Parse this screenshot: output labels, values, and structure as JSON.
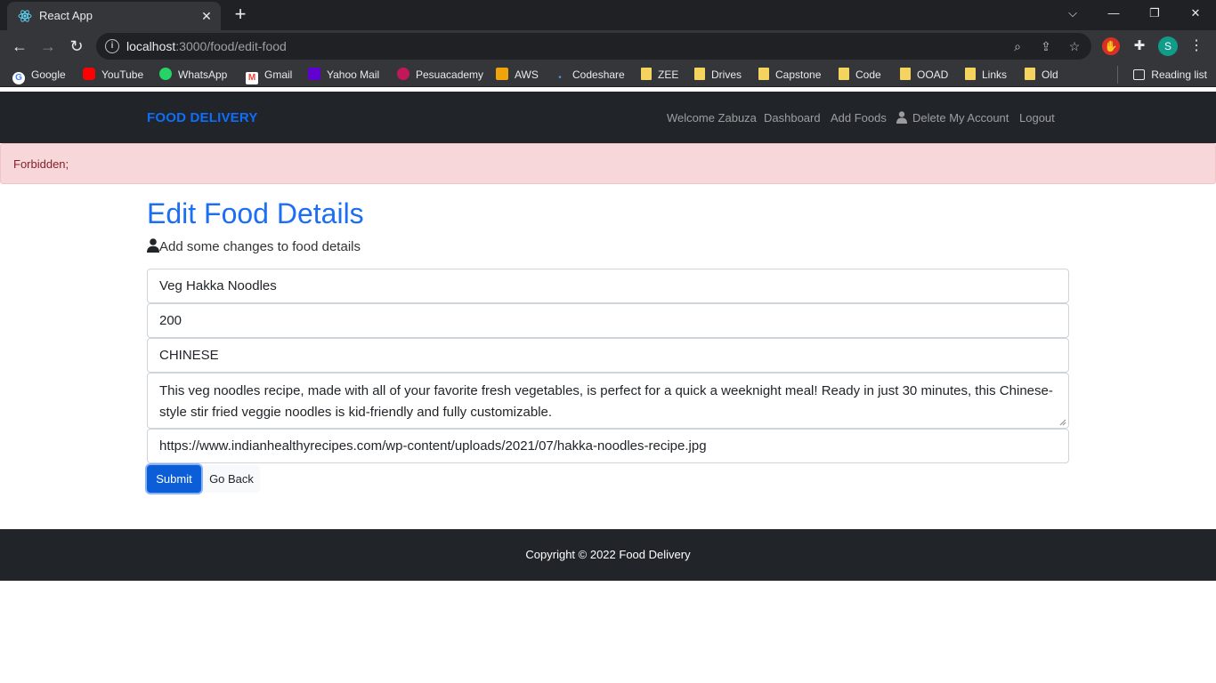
{
  "browser": {
    "tab_title": "React App",
    "url_host": "localhost",
    "url_rest": ":3000/food/edit-food",
    "profile_initial": "S",
    "bookmarks": [
      "Google",
      "YouTube",
      "WhatsApp",
      "Gmail",
      "Yahoo Mail",
      "Pesuacademy",
      "AWS",
      "Codeshare",
      "ZEE",
      "Drives",
      "Capstone",
      "Code",
      "OOAD",
      "Links",
      "Old"
    ],
    "reading_list": "Reading list"
  },
  "navbar": {
    "brand": "FOOD DELIVERY",
    "links": [
      "Welcome Zabuza",
      "Dashboard",
      "Add Foods",
      "Delete My Account",
      "Logout"
    ]
  },
  "alert": {
    "text": "Forbidden;"
  },
  "main": {
    "title": "Edit Food Details",
    "subtitle": "Add some changes to food details",
    "fields": {
      "name": "Veg Hakka Noodles",
      "price": "200",
      "category": "CHINESE",
      "description": "This veg noodles recipe, made with all of your favorite fresh vegetables, is perfect for a quick a weeknight meal! Ready in just 30 minutes, this Chinese-style stir fried veggie noodles is kid-friendly and fully customizable.",
      "image_url": "https://www.indianhealthyrecipes.com/wp-content/uploads/2021/07/hakka-noodles-recipe.jpg"
    },
    "submit_label": "Submit",
    "back_label": "Go Back"
  },
  "footer": {
    "text": "Copyright © 2022 Food Delivery"
  },
  "colors": {
    "brand": "#0d6efd",
    "navbar": "#212529",
    "alert_bg": "#f8d7da",
    "alert_text": "#842029",
    "submit": "#0b5ed7"
  }
}
